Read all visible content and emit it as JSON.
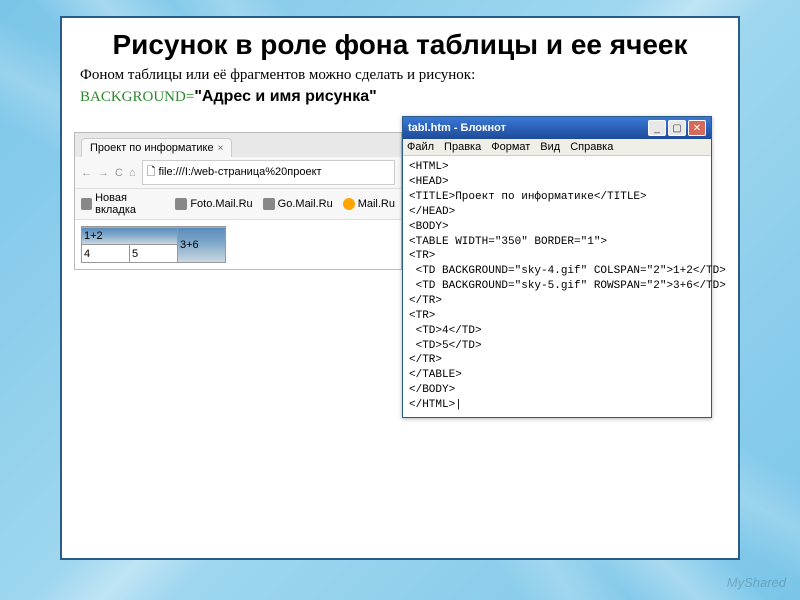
{
  "slide": {
    "title": "Рисунок в роле фона таблицы и ее ячеек",
    "intro": "Фоном таблицы или её фрагментов можно сделать и рисунок:",
    "attr_name": "BACKGROUND",
    "attr_eq": "=",
    "attr_value": "\"Адрес и имя рисунка\""
  },
  "browser": {
    "tab_title": "Проект по информатике",
    "tab_close": "×",
    "nav_back": "←",
    "nav_fwd": "→",
    "reload": "C",
    "home": "⌂",
    "url_icon": "🗋",
    "url": "file:///I:/web-страница%20проект",
    "bookmarks": [
      {
        "icon": "doc",
        "label": "Новая вкладка"
      },
      {
        "icon": "doc",
        "label": "Foto.Mail.Ru"
      },
      {
        "icon": "doc",
        "label": "Go.Mail.Ru"
      },
      {
        "icon": "at",
        "label": "Mail.Ru"
      }
    ],
    "table": {
      "c_1_2": "1+2",
      "c_3_6": "3+6",
      "c_4": "4",
      "c_5": "5"
    }
  },
  "notepad": {
    "title": "tabl.htm - Блокнот",
    "menu": [
      "Файл",
      "Правка",
      "Формат",
      "Вид",
      "Справка"
    ],
    "win_min": "_",
    "win_max": "▢",
    "win_close": "✕",
    "code_lines": [
      "<HTML>",
      "<HEAD>",
      "<TITLE>Проект по информатике</TITLE>",
      "</HEAD>",
      "<BODY>",
      "<TABLE WIDTH=\"350\" BORDER=\"1\">",
      "<TR>",
      " <TD BACKGROUND=\"sky-4.gif\" COLSPAN=\"2\">1+2</TD>",
      " <TD BACKGROUND=\"sky-5.gif\" ROWSPAN=\"2\">3+6</TD>",
      "</TR>",
      "<TR>",
      " <TD>4</TD>",
      " <TD>5</TD>",
      "</TR>",
      "</TABLE>",
      "</BODY>",
      "</HTML>|"
    ]
  },
  "watermark": "MyShared"
}
